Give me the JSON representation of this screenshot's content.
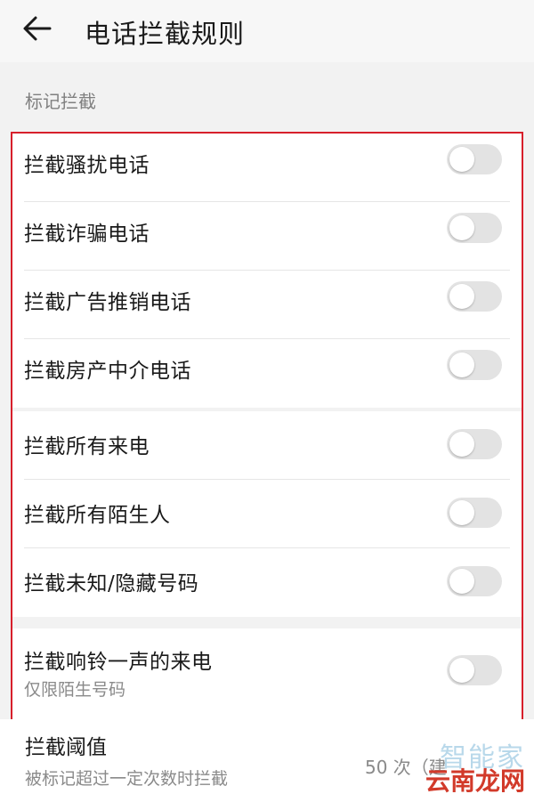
{
  "header": {
    "title": "电话拦截规则",
    "back_icon": "arrow-left-icon"
  },
  "section_label": "标记拦截",
  "group1": [
    {
      "label": "拦截骚扰电话",
      "on": false
    },
    {
      "label": "拦截诈骗电话",
      "on": false
    },
    {
      "label": "拦截广告推销电话",
      "on": false
    },
    {
      "label": "拦截房产中介电话",
      "on": false
    }
  ],
  "group2": [
    {
      "label": "拦截所有来电",
      "on": false
    },
    {
      "label": "拦截所有陌生人",
      "on": false
    },
    {
      "label": "拦截未知/隐藏号码",
      "on": false
    }
  ],
  "group3": [
    {
      "label": "拦截响铃一声的来电",
      "sub": "仅限陌生号码",
      "on": false
    }
  ],
  "threshold": {
    "label": "拦截阈值",
    "sub": "被标记超过一定次数时拦截",
    "value": "50 次（建"
  },
  "watermark": {
    "top": "智能家",
    "bottom": "云南龙网"
  },
  "colors": {
    "highlight_frame": "#d71f2b",
    "switch_off": "#e3e3e3"
  }
}
